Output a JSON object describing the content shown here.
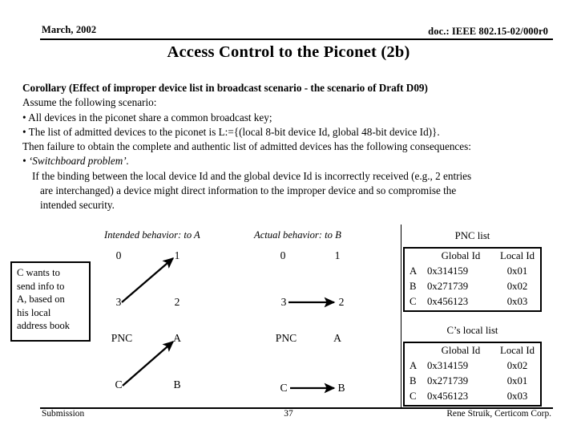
{
  "header": {
    "left": "March, 2002",
    "right": "doc.: IEEE 802.15-02/000r0"
  },
  "title": "Access Control to the Piconet (2b)",
  "body": {
    "lines": [
      {
        "text": "Corollary (Effect of improper device list in broadcast scenario - the scenario of Draft D09)",
        "style": "bold"
      },
      {
        "text": "Assume the following scenario:",
        "style": "plain"
      },
      {
        "text": "• All devices in the piconet share a common broadcast key;",
        "style": "plain"
      },
      {
        "text": "• The list of admitted devices to the piconet is L:={(local 8-bit device Id, global 48-bit device Id)}.",
        "style": "plain"
      },
      {
        "text": "Then failure to obtain the complete and authentic list of admitted devices has the following consequences:",
        "style": "plain"
      },
      {
        "text": "• ‘Switchboard problem’.",
        "style": "italic-bullet"
      },
      {
        "text": "If the binding between the local device Id and the global device Id is incorrectly received (e.g., 2 entries",
        "style": "indent1"
      },
      {
        "text": "are interchanged) a device might direct information to the improper device and so compromise the",
        "style": "indent2"
      },
      {
        "text": "intended security.",
        "style": "indent2"
      }
    ]
  },
  "info_box": {
    "lines": [
      "C wants to",
      "send info to",
      "A, based on",
      "his local",
      "address book"
    ]
  },
  "diagram_intended": {
    "title": "Intended behavior: to A",
    "nodes": {
      "top_left": "0",
      "top_right": "1",
      "mid_left": "3",
      "mid_right": "2",
      "low_left": "PNC",
      "low_right": "A",
      "bot_left": "C",
      "bot_right": "B"
    },
    "arrows": [
      {
        "from": "3",
        "to": "1",
        "kind": "diagonal"
      },
      {
        "from": "C",
        "to": "A",
        "kind": "diagonal"
      }
    ]
  },
  "diagram_actual": {
    "title": "Actual behavior: to B",
    "nodes": {
      "top_left": "0",
      "top_right": "1",
      "mid_left": "3",
      "mid_right": "2",
      "low_left": "PNC",
      "low_right": "A",
      "bot_left": "C",
      "bot_right": "B"
    },
    "arrows": [
      {
        "from": "3",
        "to": "2",
        "kind": "horizontal"
      },
      {
        "from": "C",
        "to": "B",
        "kind": "horizontal"
      }
    ]
  },
  "pnc_list": {
    "caption": "PNC list",
    "columns": [
      "",
      "Global Id",
      "Local Id"
    ],
    "rows": [
      [
        "A",
        "0x314159",
        "0x01"
      ],
      [
        "B",
        "0x271739",
        "0x02"
      ],
      [
        "C",
        "0x456123",
        "0x03"
      ]
    ]
  },
  "c_local_list": {
    "caption": "C’s local list",
    "columns": [
      "",
      "Global Id",
      "Local Id"
    ],
    "rows": [
      [
        "A",
        "0x314159",
        "0x02"
      ],
      [
        "B",
        "0x271739",
        "0x01"
      ],
      [
        "C",
        "0x456123",
        "0x03"
      ]
    ]
  },
  "footer": {
    "left": "Submission",
    "center": "37",
    "right": "Rene Struik, Certicom Corp."
  },
  "colors": {
    "ink": "#000000",
    "page": "#ffffff"
  }
}
